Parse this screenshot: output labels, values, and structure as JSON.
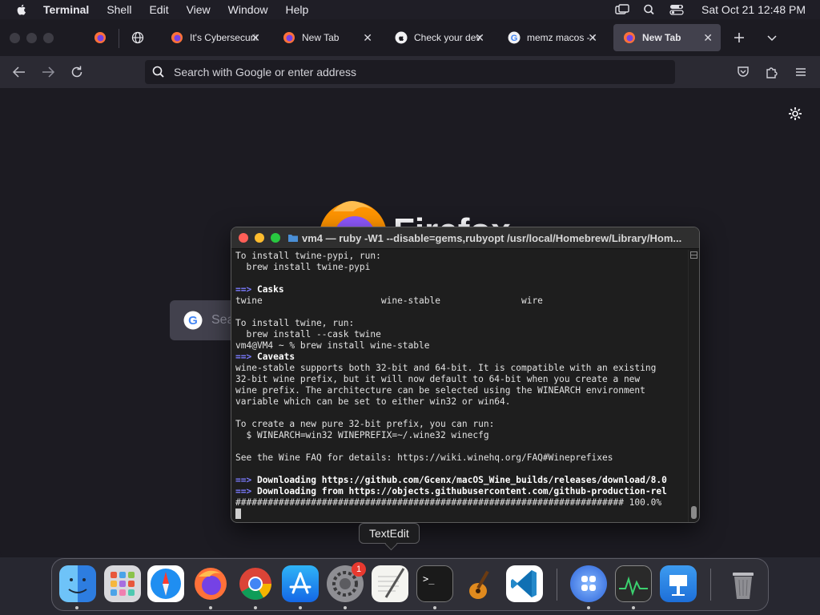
{
  "menubar": {
    "app": "Terminal",
    "items": [
      "Shell",
      "Edit",
      "View",
      "Window",
      "Help"
    ],
    "datetime": "Sat Oct 21  12:48 PM"
  },
  "browser": {
    "tabs": [
      {
        "title": "It's Cybersecurity",
        "favicon": "firefox-icon"
      },
      {
        "title": "New Tab",
        "favicon": "firefox-icon"
      },
      {
        "title": "Check your device",
        "favicon": "apple-icon"
      },
      {
        "title": "memz macos - Google",
        "favicon": "google-icon"
      },
      {
        "title": "New Tab",
        "favicon": "firefox-icon",
        "active": true
      }
    ],
    "url_placeholder": "Search with Google or enter address",
    "brand": "Firefox",
    "google_search_placeholder": "Sea"
  },
  "terminal": {
    "title": "vm4 — ruby -W1 --disable=gems,rubyopt /usr/local/Homebrew/Library/Hom...",
    "lines": [
      {
        "t": "To install twine-pypi, run:"
      },
      {
        "t": "  brew install twine-pypi"
      },
      {
        "t": ""
      },
      {
        "arrow": "==>",
        "b": "Casks"
      },
      {
        "t": "twine                      wine-stable               wire"
      },
      {
        "t": ""
      },
      {
        "t": "To install twine, run:"
      },
      {
        "t": "  brew install --cask twine"
      },
      {
        "t": "vm4@VM4 ~ % brew install wine-stable"
      },
      {
        "arrow": "==>",
        "b": "Caveats"
      },
      {
        "t": "wine-stable supports both 32-bit and 64-bit. It is compatible with an existing"
      },
      {
        "t": "32-bit wine prefix, but it will now default to 64-bit when you create a new"
      },
      {
        "t": "wine prefix. The architecture can be selected using the WINEARCH environment"
      },
      {
        "t": "variable which can be set to either win32 or win64."
      },
      {
        "t": ""
      },
      {
        "t": "To create a new pure 32-bit prefix, you can run:"
      },
      {
        "t": "  $ WINEARCH=win32 WINEPREFIX=~/.wine32 winecfg"
      },
      {
        "t": ""
      },
      {
        "t": "See the Wine FAQ for details: https://wiki.winehq.org/FAQ#Wineprefixes"
      },
      {
        "t": ""
      },
      {
        "arrow": "==>",
        "b": "Downloading https://github.com/Gcenx/macOS_Wine_builds/releases/download/8.0"
      },
      {
        "arrow": "==>",
        "b": "Downloading from https://objects.githubusercontent.com/github-production-rel"
      },
      {
        "t": "######################################################################## 100.0%"
      }
    ]
  },
  "dock": {
    "tooltip": "TextEdit",
    "badge": "1",
    "apps": [
      "Finder",
      "Launchpad",
      "Safari",
      "Firefox",
      "Chrome",
      "App Store",
      "System Settings",
      "TextEdit",
      "Terminal",
      "GarageBand",
      "Visual Studio Code",
      "UTM",
      "Activity Monitor",
      "Keynote",
      "Trash"
    ]
  }
}
